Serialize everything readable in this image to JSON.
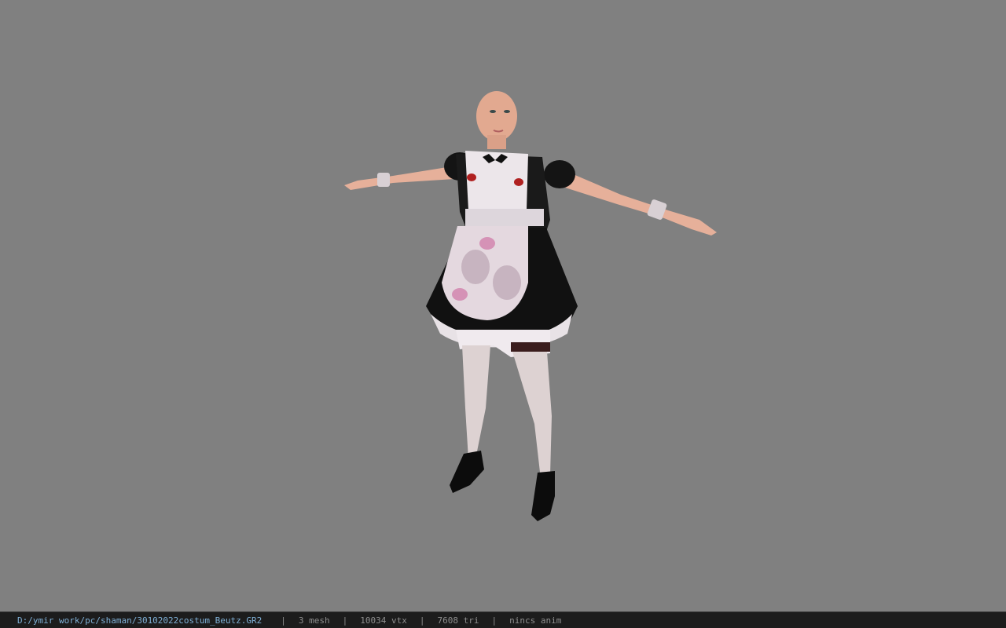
{
  "viewport": {
    "background_color": "#808080",
    "model_description_icon": "character-model-icon"
  },
  "status_bar": {
    "file_path": "D:/ymir work/pc/shaman/30102022costum_Beutz.GR2",
    "separator": "|",
    "mesh_count": "3 mesh",
    "vertex_count": "10034 vtx",
    "triangle_count": "7608 tri",
    "anim_status": "nincs anim",
    "path_color": "#7fb0d6"
  }
}
